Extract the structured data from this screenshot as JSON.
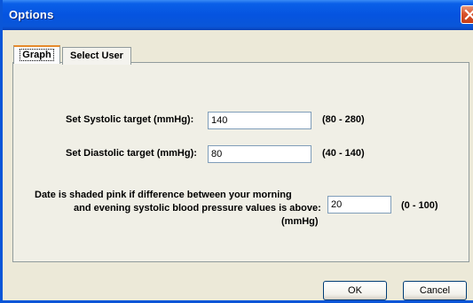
{
  "window": {
    "title": "Options"
  },
  "tabs": [
    {
      "label": "Graph"
    },
    {
      "label": "Select User"
    }
  ],
  "form": {
    "systolic": {
      "label": "Set Systolic target (mmHg):",
      "value": "140",
      "range": "(80 - 280)"
    },
    "diastolic": {
      "label": "Set Diastolic target (mmHg):",
      "value": "80",
      "range": "(40 - 140)"
    },
    "difference": {
      "label_line1": "Date is shaded pink if difference between your morning",
      "label_line2": "and evening systolic blood pressure values is above:",
      "label_line3": "(mmHg)",
      "value": "20",
      "range": "(0 - 100)"
    }
  },
  "buttons": {
    "ok": "OK",
    "cancel": "Cancel"
  },
  "colors": {
    "titlebar": "#0A56D8",
    "close_button": "#D9532C",
    "dialog_background": "#ECE9D8",
    "tab_highlight": "#E68B2C"
  },
  "icons": {
    "close": "close-icon"
  }
}
